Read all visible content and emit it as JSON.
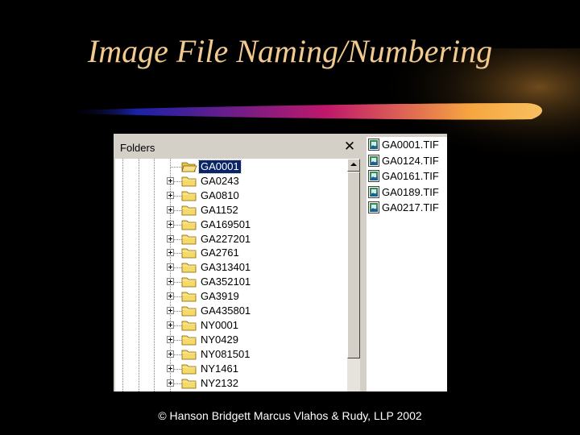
{
  "slide": {
    "title": "Image File Naming/Numbering",
    "footer": "© Hanson Bridgett Marcus Vlahos & Rudy, LLP  2002"
  },
  "folders_pane": {
    "header": "Folders",
    "close_glyph": "✕",
    "items": [
      {
        "label": "GA0001",
        "selected": true,
        "expandable": false
      },
      {
        "label": "GA0243",
        "expandable": true
      },
      {
        "label": "GA0810",
        "expandable": true
      },
      {
        "label": "GA1152",
        "expandable": true
      },
      {
        "label": "GA169501",
        "expandable": true
      },
      {
        "label": "GA227201",
        "expandable": true
      },
      {
        "label": "GA2761",
        "expandable": true
      },
      {
        "label": "GA313401",
        "expandable": true
      },
      {
        "label": "GA352101",
        "expandable": true
      },
      {
        "label": "GA3919",
        "expandable": true
      },
      {
        "label": "GA435801",
        "expandable": true
      },
      {
        "label": "NY0001",
        "expandable": true
      },
      {
        "label": "NY0429",
        "expandable": true
      },
      {
        "label": "NY081501",
        "expandable": true
      },
      {
        "label": "NY1461",
        "expandable": true
      },
      {
        "label": "NY2132",
        "expandable": true
      }
    ]
  },
  "files_pane": {
    "items": [
      {
        "label": "GA0001.TIF",
        "icon": "tif-image-icon"
      },
      {
        "label": "GA0124.TIF",
        "icon": "tif-image-icon"
      },
      {
        "label": "GA0161.TIF",
        "icon": "tif-image-icon"
      },
      {
        "label": "GA0189.TIF",
        "icon": "tif-image-icon"
      },
      {
        "label": "GA0217.TIF",
        "icon": "tif-image-icon"
      }
    ]
  },
  "colors": {
    "title": "#f2c98e",
    "background": "#000000",
    "selection": "#0a246a",
    "folder": "#f5d969",
    "swoosh_start": "#1a22a8",
    "swoosh_mid": "#c0186a",
    "swoosh_end": "#f6a640"
  }
}
